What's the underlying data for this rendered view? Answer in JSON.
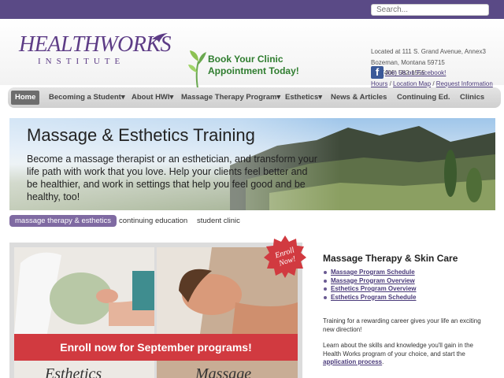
{
  "search": {
    "placeholder": "Search..."
  },
  "logo": {
    "name": "HEALTHWORKS",
    "sub": "INSTITUTE"
  },
  "book": {
    "line1": "Book Your Clinic",
    "line2": "Appointment Today!"
  },
  "contact": {
    "address1": "Located at 111 S. Grand Avenue, Annex3",
    "address2": "Bozeman, Montana 59715",
    "phone": "Ph. (406) 582-1555",
    "hours": "Hours",
    "map": "Location Map",
    "request": "Request Information",
    "separator": "/",
    "facebook": "Join Us on Facebook!"
  },
  "nav": {
    "items": [
      {
        "label": "Home"
      },
      {
        "label": "Becoming a Student▾"
      },
      {
        "label": "About HWI▾"
      },
      {
        "label": "Massage Therapy Program▾"
      },
      {
        "label": "Esthetics▾"
      },
      {
        "label": "News & Articles"
      },
      {
        "label": "Continuing Ed."
      },
      {
        "label": "Clinics"
      }
    ]
  },
  "hero": {
    "title": "Massage & Esthetics Training",
    "text": "Become a massage therapist or an esthetician, and transform your life path with work that you love. Help your clients feel better and be healthier, and work in settings that help you feel good and be healthy, too!"
  },
  "subtabs": [
    {
      "label": "massage therapy & esthetics"
    },
    {
      "label": "continuing education"
    },
    {
      "label": "student clinic"
    }
  ],
  "promo": {
    "banner": "Enroll now for September programs!",
    "seal": "Enroll Now!",
    "left_label": "Esthetics",
    "right_label": "Massage"
  },
  "right": {
    "title": "Massage Therapy & Skin Care",
    "links": [
      {
        "label": "Massage Program Schedule"
      },
      {
        "label": "Massage Program Overview"
      },
      {
        "label": "Esthetics Program Overview"
      },
      {
        "label": "Esthetics Program Schedule"
      }
    ],
    "para1": "Training for a rewarding career gives your life an exciting new direction!",
    "para2": "Learn about the skills and knowledge you'll gain in the Health Works program of your choice, and start the",
    "para2_link": "application process",
    "para2_end": "."
  },
  "colors": {
    "topbar": "#5a4a86",
    "brand_purple": "#5d3c86",
    "book_green": "#2f7d2f",
    "banner_red": "#d13a40",
    "nav_active": "#6d6d6d"
  }
}
